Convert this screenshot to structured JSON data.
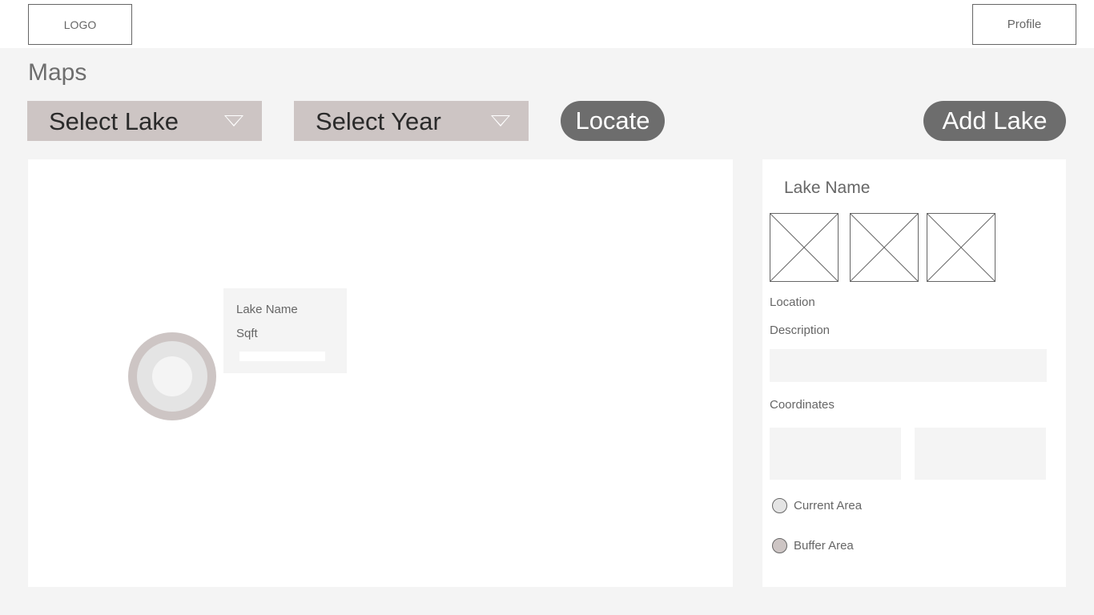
{
  "header": {
    "logo": "LOGO",
    "profile": "Profile"
  },
  "page": {
    "title": "Maps"
  },
  "toolbar": {
    "select_lake": "Select Lake",
    "select_year": "Select Year",
    "locate": "Locate",
    "add_lake": "Add Lake"
  },
  "map": {
    "popup": {
      "name": "Lake Name",
      "area_unit": "Sqft"
    }
  },
  "details": {
    "lake_name": "Lake Name",
    "location_label": "Location",
    "description_label": "Description",
    "description_value": "",
    "coordinates_label": "Coordinates",
    "coordinate_1": "",
    "coordinate_2": "",
    "legend": [
      {
        "label": "Current Area",
        "color": "#e4e4e4"
      },
      {
        "label": "Buffer Area",
        "color": "#cdc5c4"
      }
    ]
  },
  "colors": {
    "accent_pill": "#6d6d6d",
    "select_bg": "#cdc5c4",
    "panel_bg": "#ffffff",
    "page_bg": "#f4f4f4"
  }
}
